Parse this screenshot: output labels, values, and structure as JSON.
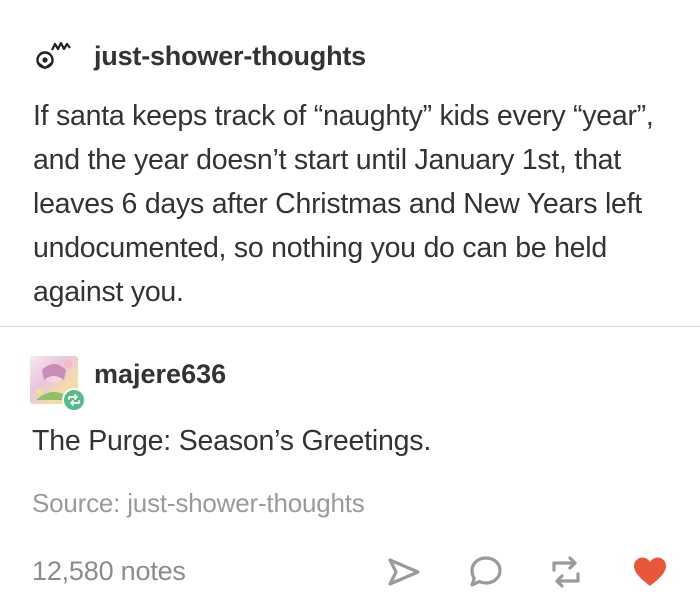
{
  "post": {
    "username": "just-shower-thoughts",
    "avatar_icon": "pixel-doodle-avatar-icon",
    "body": "If santa keeps track of “naughty” kids every “year”, and the year doesn’t start until January 1st, that leaves 6 days after Christmas and New Years left undocumented, so nothing you do can be held against you."
  },
  "reblog": {
    "username": "majere636",
    "avatar_icon": "anime-avatar-icon",
    "badge_icon": "reblog-badge-icon",
    "comment": "The Purge: Season’s Greetings."
  },
  "source": {
    "text": "Source: just-shower-thoughts"
  },
  "footer": {
    "notes": "12,580 notes",
    "icons": [
      "share-icon",
      "reply-icon",
      "reblog-icon",
      "like-icon"
    ],
    "like_color": "#e8573a",
    "icon_color": "#9a9a9a"
  }
}
